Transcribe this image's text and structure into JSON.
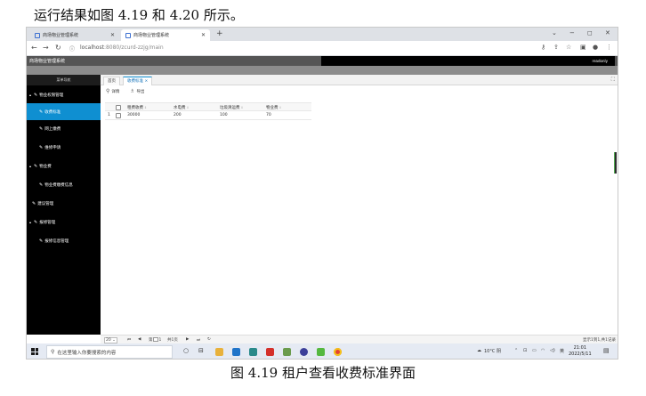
{
  "intro": "运行结果如图 4.19 和 4.20 所示。",
  "caption": "图 4.19 租户查看收费标准界面",
  "browser": {
    "tabs": [
      {
        "label": "商场物业管理系统"
      },
      {
        "label": "商场物业管理系统"
      }
    ],
    "new_tab": "+",
    "url_host": "localhost",
    "url_path": ":8080/zcurd-zzjg/main"
  },
  "app": {
    "title": "商场物业管理系统",
    "user": "readonly",
    "sidebar_header": "菜单导航",
    "sidebar": [
      {
        "label": "物业权限管理",
        "type": "group"
      },
      {
        "label": "收费标准",
        "type": "child",
        "active": true
      },
      {
        "label": "网上缴费",
        "type": "child"
      },
      {
        "label": "维修申请",
        "type": "child"
      },
      {
        "label": "物业费",
        "type": "group"
      },
      {
        "label": "物业费缴费信息",
        "type": "child"
      },
      {
        "label": "建议管理",
        "type": "item"
      },
      {
        "label": "报修管理",
        "type": "group"
      },
      {
        "label": "报修信息管理",
        "type": "child"
      }
    ],
    "content_tabs": {
      "home": "首页",
      "current": "收费标准",
      "current_close": "×"
    },
    "toolbar": {
      "detail": "详情",
      "export": "导出"
    },
    "grid": {
      "headers": [
        "租费收费",
        "水电费",
        "垃圾清运费",
        "物业费"
      ],
      "rows": [
        {
          "index": "1",
          "cells": [
            "30000",
            "200",
            "100",
            "70"
          ]
        }
      ]
    },
    "pager": {
      "page_size": "20",
      "page_prefix": "第",
      "page_no": "1",
      "page_total": "共1页",
      "summary": "显示1到1,共1记录"
    }
  },
  "taskbar": {
    "search_placeholder": "在这里输入你要搜索的内容",
    "weather": "10°C 阴",
    "lang": "英",
    "time": "21:01",
    "date": "2022/5/11"
  },
  "colors": {
    "sidebar_active": "#0f8fd1",
    "sidebar_bg": "#000000",
    "header_gray": "#555555"
  }
}
